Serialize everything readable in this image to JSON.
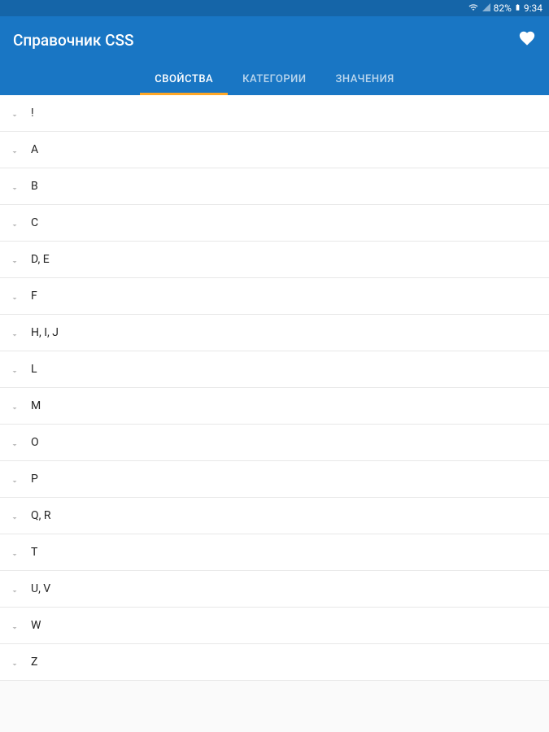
{
  "status": {
    "battery": "82%",
    "time": "9:34"
  },
  "header": {
    "title": "Справочник CSS"
  },
  "tabs": [
    {
      "label": "СВОЙСТВА",
      "active": true
    },
    {
      "label": "КАТЕГОРИИ",
      "active": false
    },
    {
      "label": "ЗНАЧЕНИЯ",
      "active": false
    }
  ],
  "list_items": [
    {
      "label": "!"
    },
    {
      "label": "A"
    },
    {
      "label": "B"
    },
    {
      "label": "C"
    },
    {
      "label": "D, E"
    },
    {
      "label": "F"
    },
    {
      "label": "H, I, J"
    },
    {
      "label": "L"
    },
    {
      "label": "M"
    },
    {
      "label": "O"
    },
    {
      "label": "P"
    },
    {
      "label": "Q, R"
    },
    {
      "label": "T"
    },
    {
      "label": "U, V"
    },
    {
      "label": "W"
    },
    {
      "label": "Z"
    }
  ]
}
